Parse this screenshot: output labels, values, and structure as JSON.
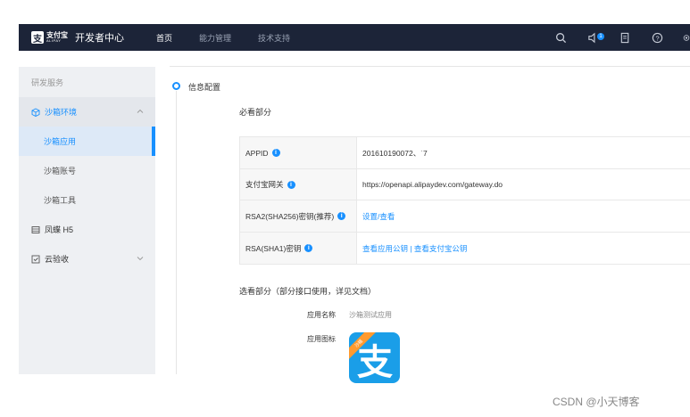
{
  "topbar": {
    "brand_cn": "支付宝",
    "brand_en": "ALIPAY",
    "title": "开发者中心",
    "nav": [
      {
        "label": "首页",
        "active": true
      },
      {
        "label": "能力管理",
        "active": false
      },
      {
        "label": "技术支持",
        "active": false
      }
    ],
    "notification_count": "1",
    "tools": [
      "search-icon",
      "speaker-icon",
      "document-icon",
      "help-icon",
      "settings-icon"
    ]
  },
  "sidebar": {
    "header": "研发服务",
    "groups": [
      {
        "label": "沙箱环境",
        "icon": "cube-icon",
        "open": true
      },
      {
        "label": "凤蝶 H5",
        "icon": "grid-icon"
      },
      {
        "label": "云验收",
        "icon": "check-icon"
      }
    ],
    "sub_items": [
      {
        "label": "沙箱应用",
        "active": true
      },
      {
        "label": "沙箱账号",
        "active": false
      },
      {
        "label": "沙箱工具",
        "active": false
      }
    ]
  },
  "main": {
    "step_title": "信息配置",
    "required_title": "必看部分",
    "rows": [
      {
        "label": "APPID",
        "value": "201610190072、˙7",
        "link": false
      },
      {
        "label": "支付宝网关",
        "value": "https://openapi.alipaydev.com/gateway.do",
        "link": false
      },
      {
        "label": "RSA2(SHA256)密钥(推荐)",
        "value": "设置/查看",
        "link": true
      },
      {
        "label": "RSA(SHA1)密钥",
        "value": "查看应用公钥 | 查看支付宝公钥",
        "link": true
      }
    ],
    "optional_title": "选看部分（部分接口使用，详见文档）",
    "app_name_label": "应用名称",
    "app_name_value": "沙箱测试应用",
    "app_icon_label": "应用图标",
    "app_icon_ribbon": "沙箱",
    "app_icon_glyph": "支"
  },
  "watermark": "CSDN @小天博客",
  "colors": {
    "accent": "#1890ff",
    "topbar": "#1c2438",
    "sidebar": "#eef0f3",
    "app_icon": "#1a9ee8"
  }
}
